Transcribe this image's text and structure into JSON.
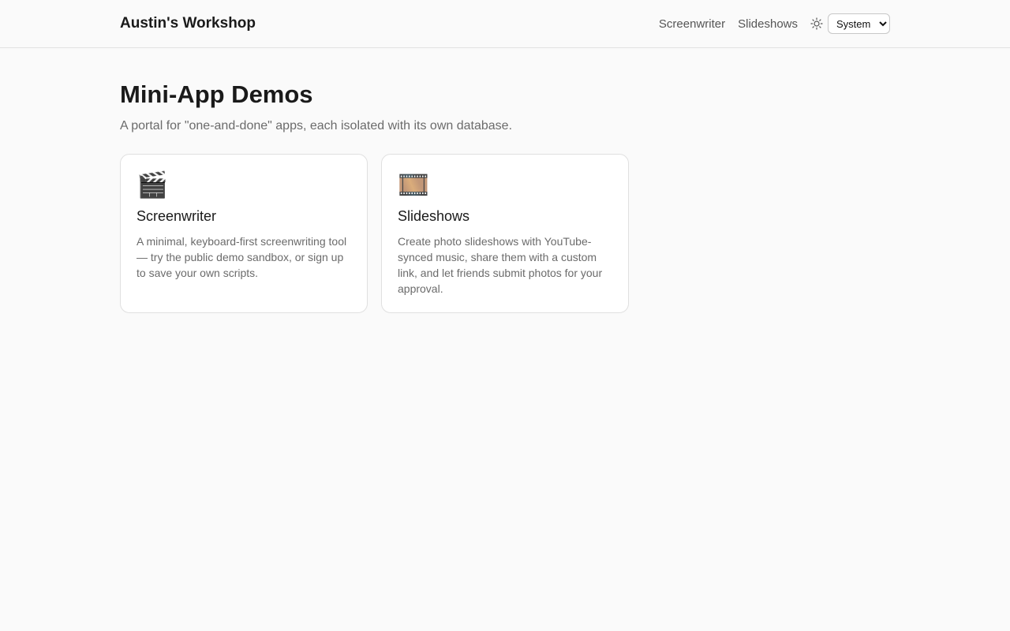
{
  "header": {
    "brand": "Austin's Workshop",
    "nav": [
      {
        "label": "Screenwriter"
      },
      {
        "label": "Slideshows"
      }
    ],
    "theme_icon": "sun-icon",
    "theme_select": {
      "value": "System",
      "options": [
        "System"
      ]
    }
  },
  "main": {
    "title": "Mini-App Demos",
    "subtitle": "A portal for \"one-and-done\" apps, each isolated with its own database.",
    "cards": [
      {
        "icon": "🎬",
        "icon_name": "clapper-board-icon",
        "title": "Screenwriter",
        "description": "A minimal, keyboard-first screenwriting tool — try the public demo sandbox, or sign up to save your own scripts."
      },
      {
        "icon": "🎞️",
        "icon_name": "film-frames-icon",
        "title": "Slideshows",
        "description": "Create photo slideshows with YouTube-synced music, share them with a custom link, and let friends submit photos for your approval."
      }
    ]
  },
  "colors": {
    "background": "#fafafa",
    "card_background": "#ffffff",
    "border": "#e0e0e0",
    "muted_text": "#6b6b6b"
  }
}
